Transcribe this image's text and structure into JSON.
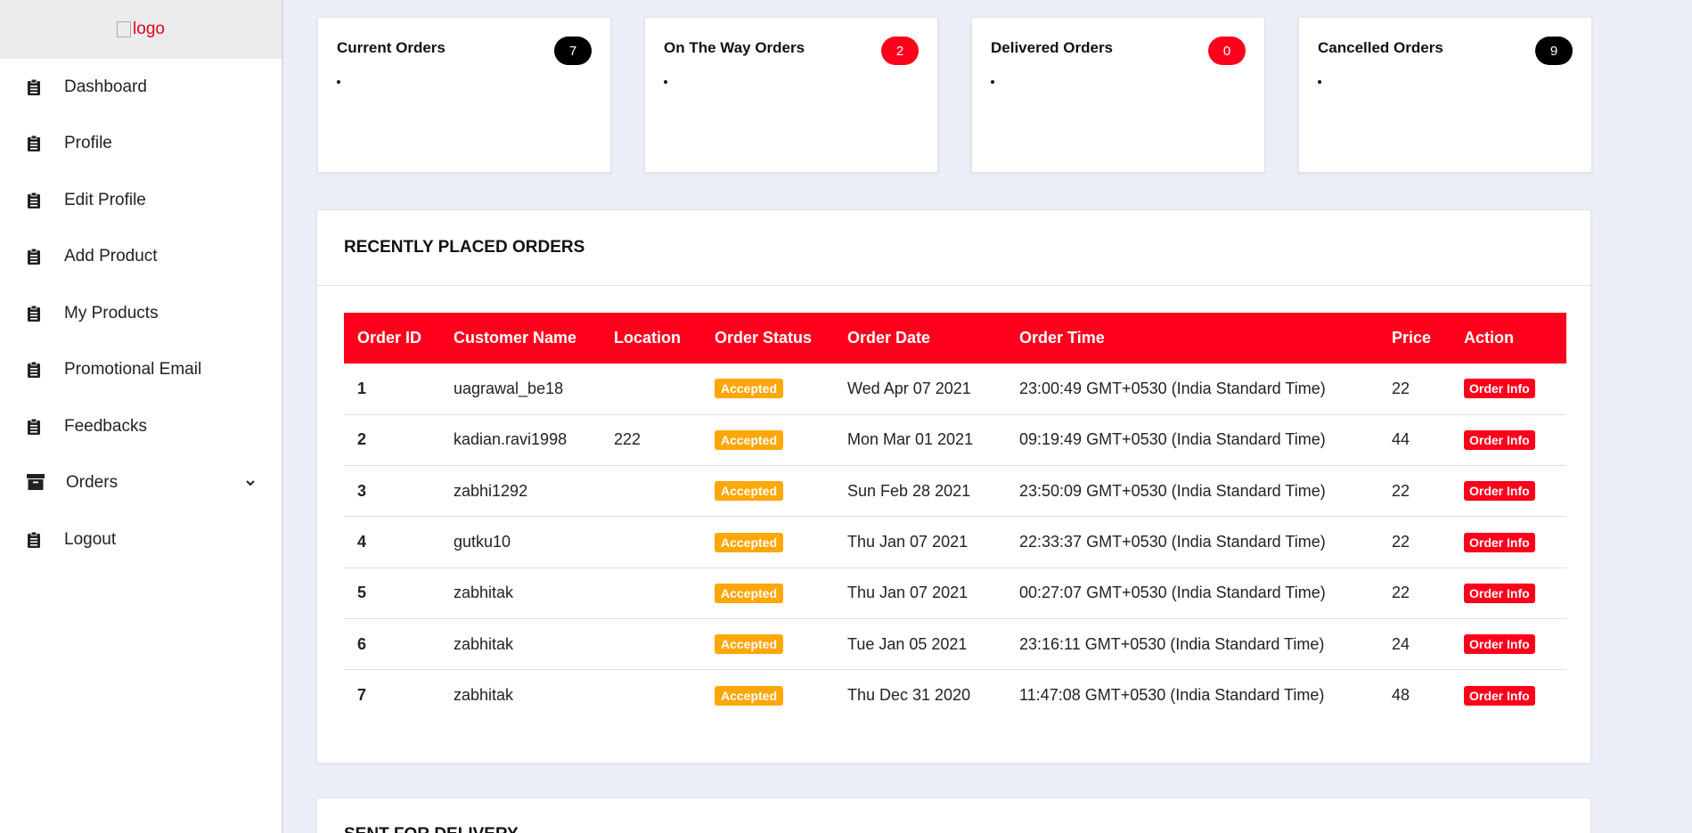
{
  "logo": {
    "alt": "logo"
  },
  "sidebar": {
    "items": [
      {
        "label": "Dashboard",
        "icon": "clipboard-icon"
      },
      {
        "label": "Profile",
        "icon": "clipboard-icon"
      },
      {
        "label": "Edit Profile",
        "icon": "clipboard-icon"
      },
      {
        "label": "Add Product",
        "icon": "clipboard-icon"
      },
      {
        "label": "My Products",
        "icon": "clipboard-icon"
      },
      {
        "label": "Promotional Email",
        "icon": "clipboard-icon"
      },
      {
        "label": "Feedbacks",
        "icon": "clipboard-icon"
      },
      {
        "label": "Orders",
        "icon": "archive-icon",
        "expandable": true
      },
      {
        "label": "Logout",
        "icon": "clipboard-icon"
      }
    ]
  },
  "cards": [
    {
      "title": "Current Orders",
      "count": "7",
      "badge_color": "#000000"
    },
    {
      "title": "On The Way Orders",
      "count": "2",
      "badge_color": "#ff001c"
    },
    {
      "title": "Delivered Orders",
      "count": "0",
      "badge_color": "#ff001c"
    },
    {
      "title": "Cancelled Orders",
      "count": "9",
      "badge_color": "#000000"
    }
  ],
  "recent": {
    "title": "RECENTLY PLACED ORDERS",
    "columns": [
      "Order ID",
      "Customer Name",
      "Location",
      "Order Status",
      "Order Date",
      "Order Time",
      "Price",
      "Action"
    ],
    "rows": [
      {
        "id": "1",
        "customer": "uagrawal_be18",
        "location": "",
        "status": "Accepted",
        "date": "Wed Apr 07 2021",
        "time": "23:00:49 GMT+0530 (India Standard Time)",
        "price": "22",
        "action": "Order Info"
      },
      {
        "id": "2",
        "customer": "kadian.ravi1998",
        "location": "222",
        "status": "Accepted",
        "date": "Mon Mar 01 2021",
        "time": "09:19:49 GMT+0530 (India Standard Time)",
        "price": "44",
        "action": "Order Info"
      },
      {
        "id": "3",
        "customer": "zabhi1292",
        "location": "",
        "status": "Accepted",
        "date": "Sun Feb 28 2021",
        "time": "23:50:09 GMT+0530 (India Standard Time)",
        "price": "22",
        "action": "Order Info"
      },
      {
        "id": "4",
        "customer": "gutku10",
        "location": "",
        "status": "Accepted",
        "date": "Thu Jan 07 2021",
        "time": "22:33:37 GMT+0530 (India Standard Time)",
        "price": "22",
        "action": "Order Info"
      },
      {
        "id": "5",
        "customer": "zabhitak",
        "location": "",
        "status": "Accepted",
        "date": "Thu Jan 07 2021",
        "time": "00:27:07 GMT+0530 (India Standard Time)",
        "price": "22",
        "action": "Order Info"
      },
      {
        "id": "6",
        "customer": "zabhitak",
        "location": "",
        "status": "Accepted",
        "date": "Tue Jan 05 2021",
        "time": "23:16:11 GMT+0530 (India Standard Time)",
        "price": "24",
        "action": "Order Info"
      },
      {
        "id": "7",
        "customer": "zabhitak",
        "location": "",
        "status": "Accepted",
        "date": "Thu Dec 31 2020",
        "time": "11:47:08 GMT+0530 (India Standard Time)",
        "price": "48",
        "action": "Order Info"
      }
    ]
  },
  "sent_for_delivery": {
    "title": "SENT FOR DELIVERY"
  },
  "colors": {
    "accent": "#ff001c",
    "status_accepted": "#ffa707",
    "background": "#eceef8"
  }
}
